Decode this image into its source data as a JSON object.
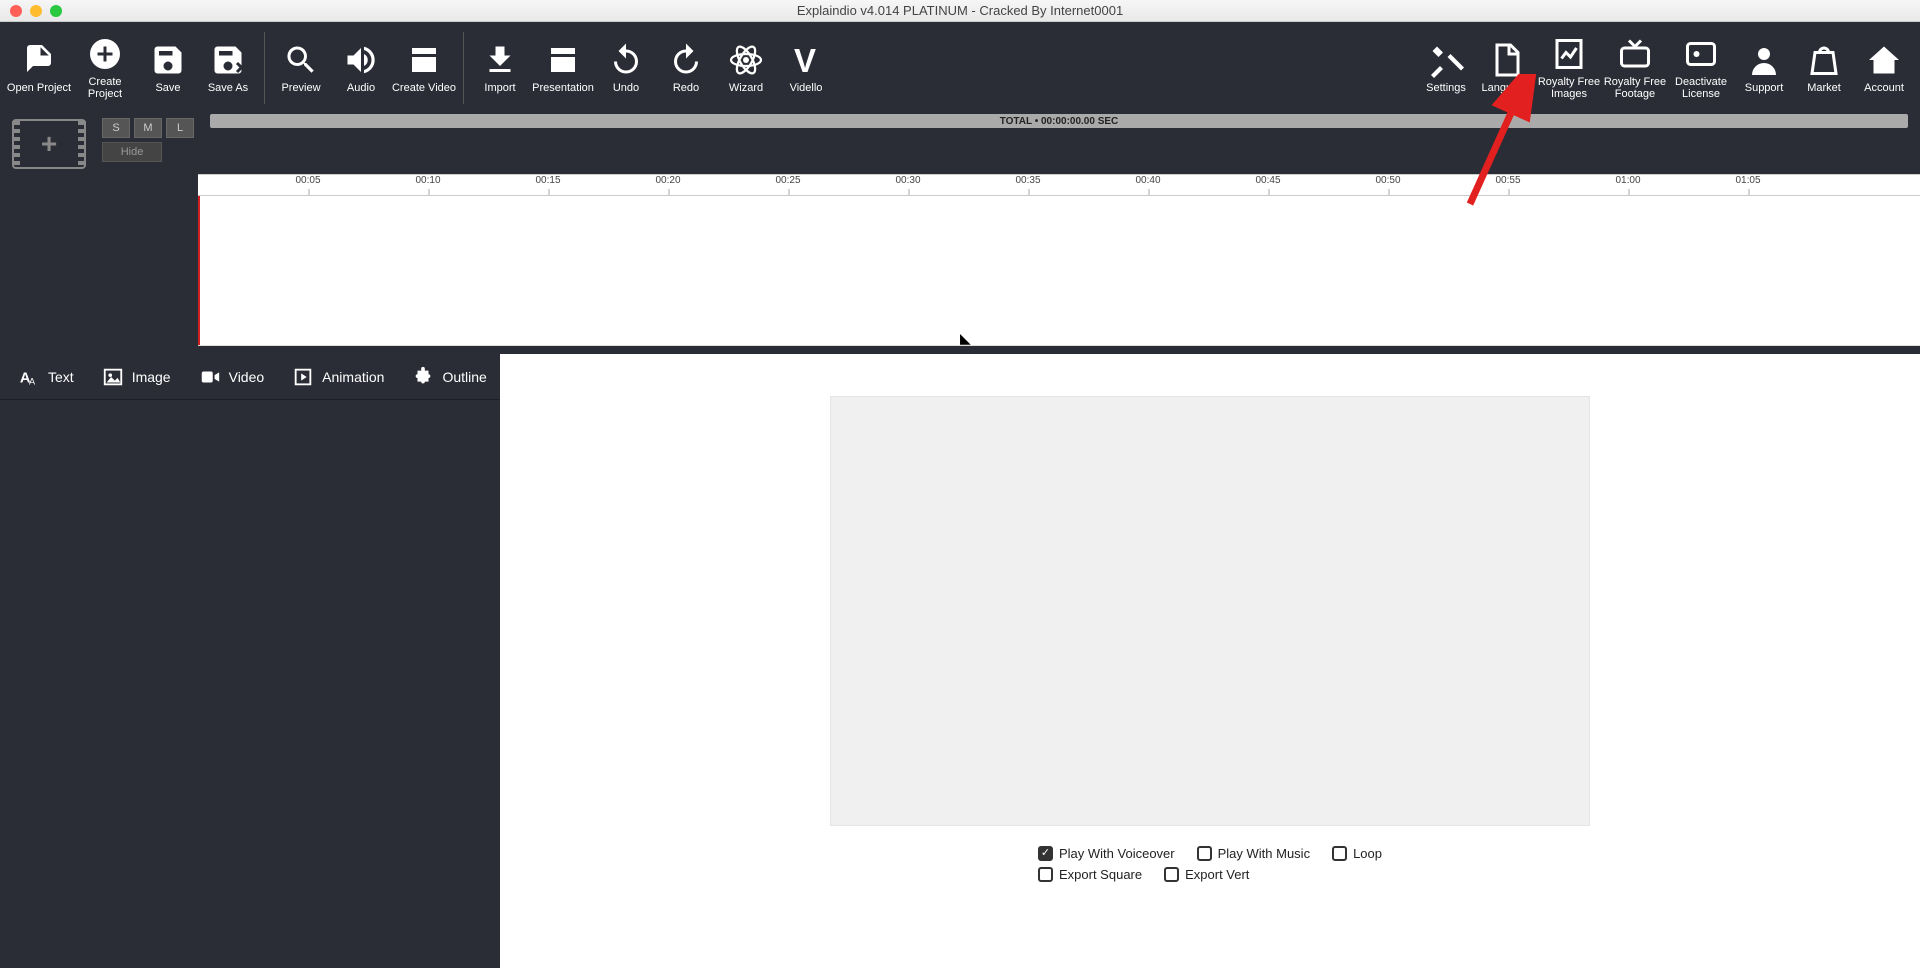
{
  "window": {
    "title": "Explaindio v4.014 PLATINUM - Cracked By Internet0001"
  },
  "toolbar_left": {
    "open_project": "Open Project",
    "create_project": "Create Project",
    "save": "Save",
    "save_as": "Save As",
    "preview": "Preview",
    "audio": "Audio",
    "create_video": "Create Video",
    "import": "Import",
    "presentation": "Presentation",
    "undo": "Undo",
    "redo": "Redo",
    "wizard": "Wizard",
    "vidello": "Vidello"
  },
  "toolbar_right": {
    "settings": "Settings",
    "language": "Language",
    "rf_images": "Royalty Free\nImages",
    "rf_footage": "Royalty Free\nFootage",
    "deactivate": "Deactivate\nLicense",
    "support": "Support",
    "market": "Market",
    "account": "Account"
  },
  "mini": {
    "s": "S",
    "m": "M",
    "l": "L",
    "hide": "Hide"
  },
  "timeline": {
    "total_label": "TOTAL • 00:00:00.00 SEC",
    "ticks": [
      "00:05",
      "00:10",
      "00:15",
      "00:20",
      "00:25",
      "00:30",
      "00:35",
      "00:40",
      "00:45",
      "00:50",
      "00:55",
      "01:00",
      "01:05"
    ]
  },
  "side_tabs": {
    "text": "Text",
    "image": "Image",
    "video": "Video",
    "animation": "Animation",
    "outline": "Outline"
  },
  "playback": {
    "voiceover": {
      "label": "Play With Voiceover",
      "checked": true
    },
    "music": {
      "label": "Play With Music",
      "checked": false
    },
    "loop": {
      "label": "Loop",
      "checked": false
    },
    "square": {
      "label": "Export Square",
      "checked": false
    },
    "vert": {
      "label": "Export Vert",
      "checked": false
    }
  }
}
